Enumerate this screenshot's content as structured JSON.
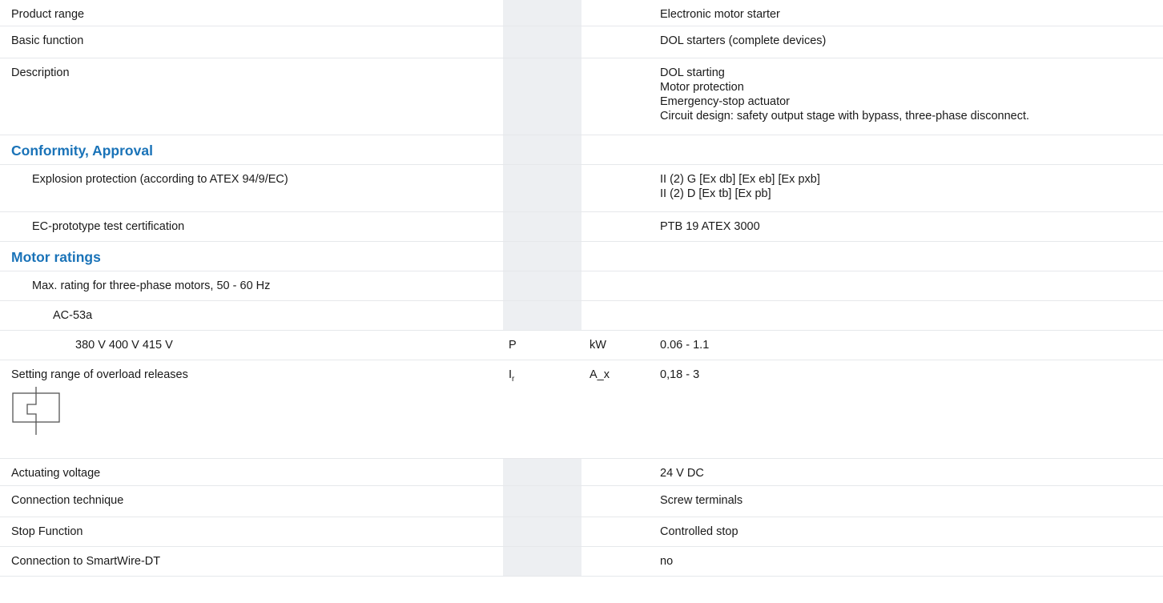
{
  "rows": {
    "product_range": {
      "label": "Product range",
      "value": "Electronic motor starter"
    },
    "basic_function": {
      "label": "Basic function",
      "value": "DOL starters (complete devices)"
    },
    "description": {
      "label": "Description",
      "values": [
        "DOL starting",
        "Motor protection",
        "Emergency-stop actuator",
        "Circuit design: safety output stage with bypass, three-phase disconnect."
      ]
    },
    "section_conformity": {
      "title": "Conformity, Approval"
    },
    "explosion_protection": {
      "label": "Explosion protection (according to ATEX 94/9/EC)",
      "values": [
        "II (2) G [Ex db] [Ex eb] [Ex pxb]",
        "II (2) D [Ex tb] [Ex pb]"
      ]
    },
    "ec_certification": {
      "label": "EC-prototype test certification",
      "value": "PTB 19 ATEX 3000"
    },
    "section_motor": {
      "title": "Motor ratings"
    },
    "max_rating": {
      "label": "Max. rating for three-phase motors, 50 - 60 Hz"
    },
    "ac53a": {
      "label": "AC-53a"
    },
    "voltage_rating": {
      "label": "380 V 400 V 415 V",
      "symbol": "P",
      "unit": "kW",
      "value": "0.06 - 1.1"
    },
    "overload": {
      "label": "Setting range of overload releases",
      "symbol_main": "I",
      "symbol_sub": "r",
      "unit": "A_x",
      "value": "0,18 - 3",
      "icon": "overload-relay-symbol-icon"
    },
    "actuating_voltage": {
      "label": "Actuating voltage",
      "value": "24 V DC"
    },
    "connection_technique": {
      "label": "Connection technique",
      "value": "Screw terminals"
    },
    "stop_function": {
      "label": "Stop Function",
      "value": "Controlled stop"
    },
    "smartwire": {
      "label": "Connection to SmartWire-DT",
      "value": "no"
    }
  }
}
